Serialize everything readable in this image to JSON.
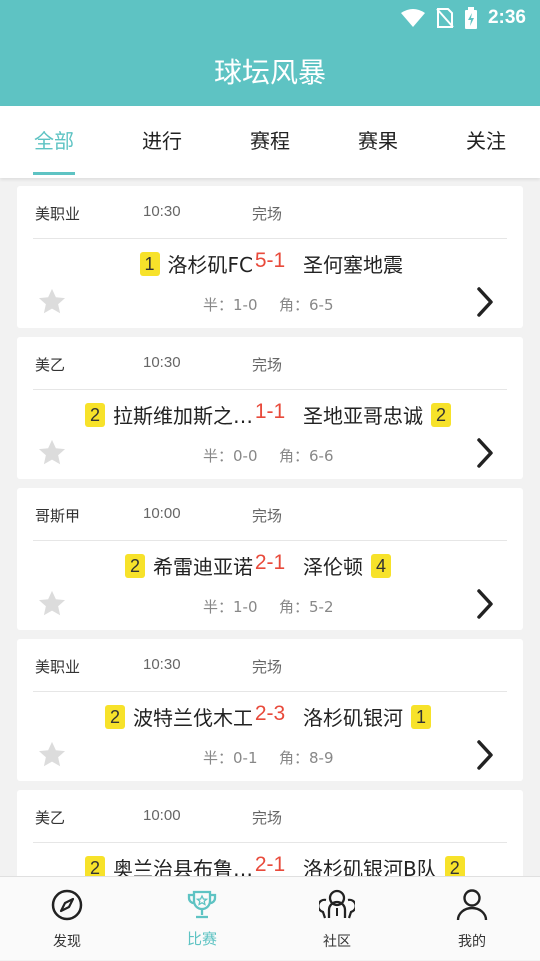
{
  "status_bar": {
    "time": "2:36"
  },
  "header": {
    "title": "球坛风暴"
  },
  "tabs": [
    {
      "label": "全部",
      "active": true
    },
    {
      "label": "进行",
      "active": false
    },
    {
      "label": "赛程",
      "active": false
    },
    {
      "label": "赛果",
      "active": false
    },
    {
      "label": "关注",
      "active": false
    }
  ],
  "matches": [
    {
      "league": "美职业",
      "time": "10:30",
      "status": "完场",
      "home": "洛杉矶FC",
      "home_badge": "1",
      "score": "5-1",
      "away": "圣何塞地震",
      "away_badge": "",
      "half": "半：1-0",
      "corner": "角：6-5"
    },
    {
      "league": "美乙",
      "time": "10:30",
      "status": "完场",
      "home": "拉斯维加斯之…",
      "home_badge": "2",
      "score": "1-1",
      "away": "圣地亚哥忠诚",
      "away_badge": "2",
      "half": "半：0-0",
      "corner": "角：6-6"
    },
    {
      "league": "哥斯甲",
      "time": "10:00",
      "status": "完场",
      "home": "希雷迪亚诺",
      "home_badge": "2",
      "score": "2-1",
      "away": "泽伦顿",
      "away_badge": "4",
      "half": "半：1-0",
      "corner": "角：5-2"
    },
    {
      "league": "美职业",
      "time": "10:30",
      "status": "完场",
      "home": "波特兰伐木工",
      "home_badge": "2",
      "score": "2-3",
      "away": "洛杉矶银河",
      "away_badge": "1",
      "half": "半：0-1",
      "corner": "角：8-9"
    },
    {
      "league": "美乙",
      "time": "10:00",
      "status": "完场",
      "home": "奥兰治县布鲁…",
      "home_badge": "2",
      "score": "2-1",
      "away": "洛杉矶银河B队",
      "away_badge": "2",
      "half": "",
      "corner": ""
    }
  ],
  "bottom_nav": [
    {
      "label": "发现",
      "icon": "compass-icon",
      "active": false
    },
    {
      "label": "比赛",
      "icon": "trophy-icon",
      "active": true
    },
    {
      "label": "社区",
      "icon": "community-icon",
      "active": false
    },
    {
      "label": "我的",
      "icon": "person-icon",
      "active": false
    }
  ],
  "colors": {
    "primary": "#5ec3c3",
    "score": "#e84a3b",
    "badge": "#f7e22a"
  }
}
